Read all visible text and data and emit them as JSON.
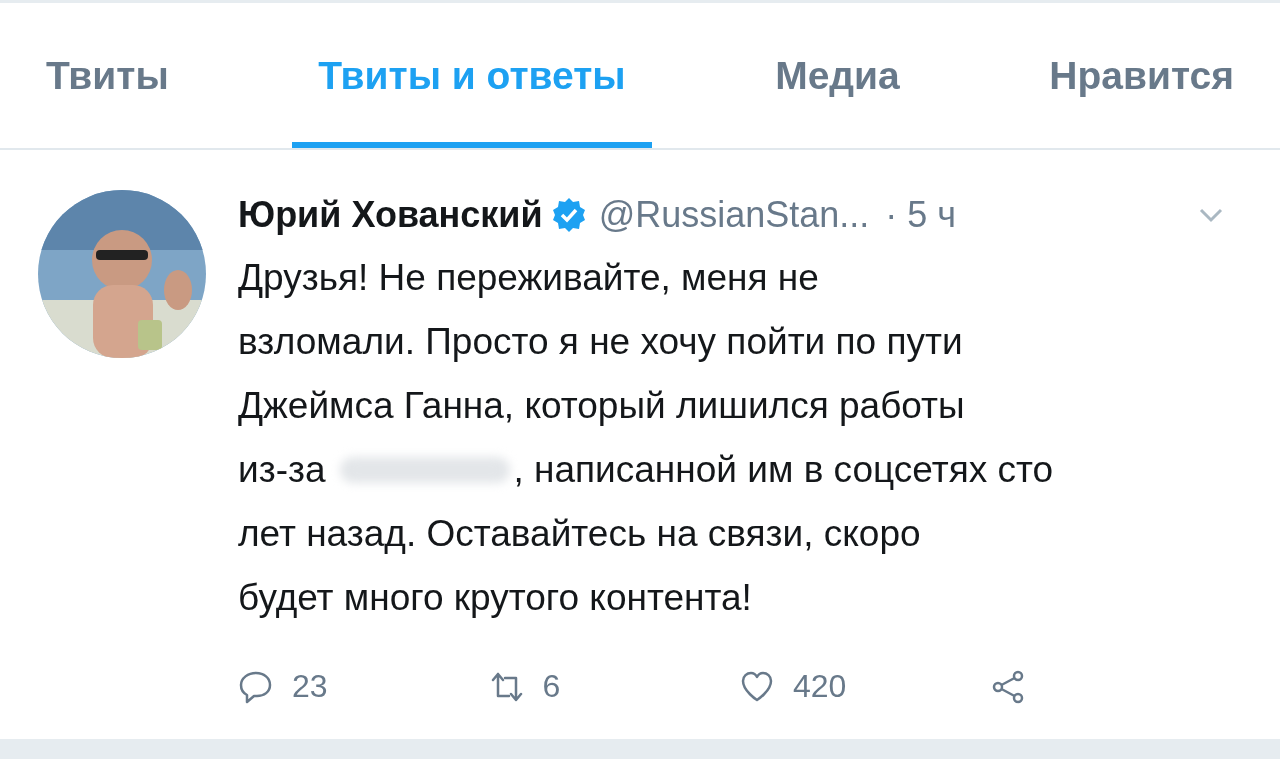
{
  "tabs": [
    {
      "label": "Твиты",
      "selected": false
    },
    {
      "label": "Твиты и ответы",
      "selected": true
    },
    {
      "label": "Медиа",
      "selected": false
    },
    {
      "label": "Нравится",
      "selected": false
    }
  ],
  "tweet": {
    "name": "Юрий Хованский",
    "verified": true,
    "handle": "@RussianStan...",
    "time": "· 5 ч",
    "text_lines": [
      {
        "kind": "plain",
        "text": "Друзья! Не переживайте, меня не"
      },
      {
        "kind": "plain",
        "text": "взломали. Просто я не хочу пойти по пути"
      },
      {
        "kind": "plain",
        "text": "Джеймса Ганна, который лишился работы"
      },
      {
        "kind": "redacted",
        "before": "из-за",
        "after": ", написанной им в соцсетях сто"
      },
      {
        "kind": "plain",
        "text": "лет назад. Оставайтесь на связи, скоро"
      },
      {
        "kind": "plain",
        "text": "будет много крутого контента!"
      }
    ],
    "actions": [
      {
        "kind": "reply",
        "count": "23"
      },
      {
        "kind": "retweet",
        "count": "6"
      },
      {
        "kind": "like",
        "count": "420"
      },
      {
        "kind": "share"
      }
    ]
  }
}
